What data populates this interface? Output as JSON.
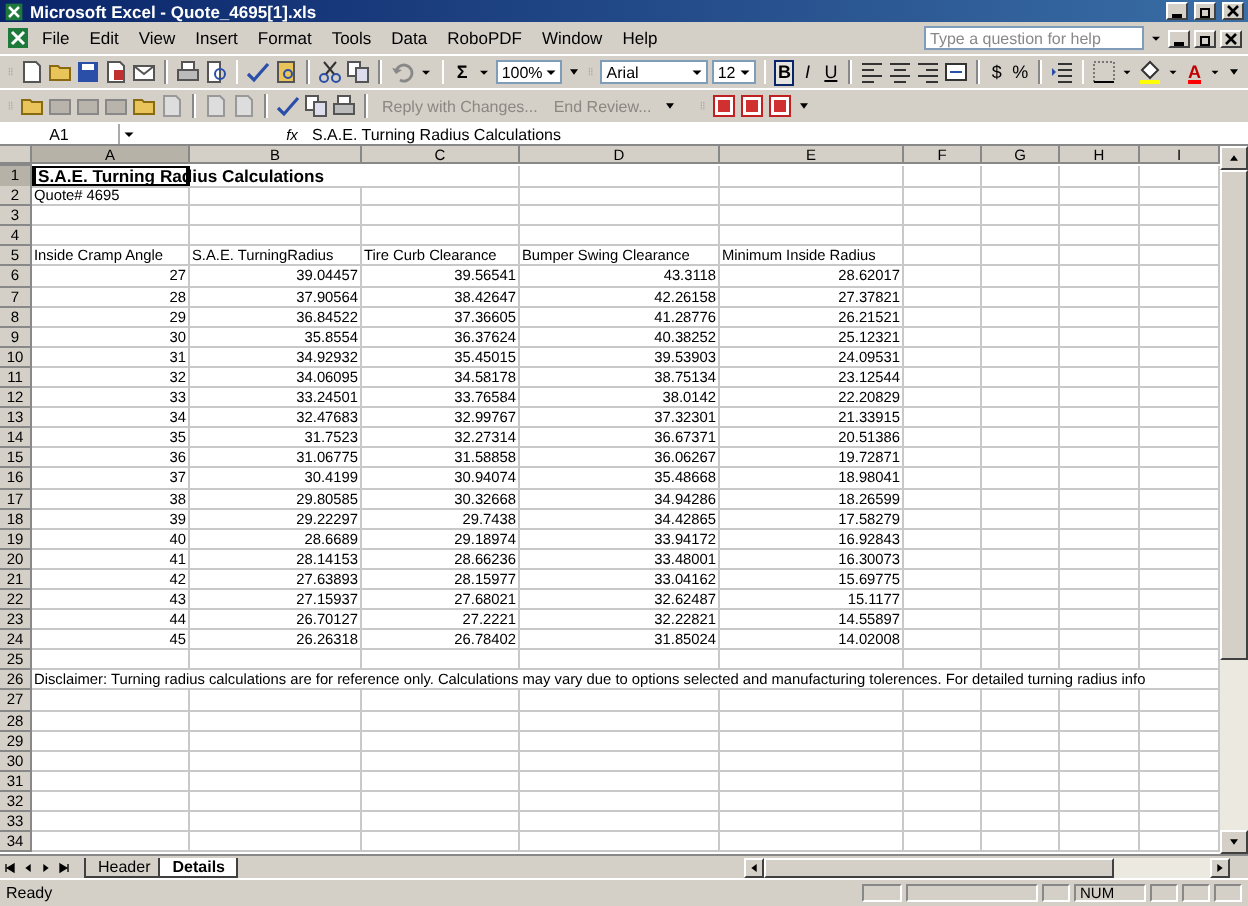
{
  "window": {
    "title": "Microsoft Excel - Quote_4695[1].xls"
  },
  "menu": [
    "File",
    "Edit",
    "View",
    "Insert",
    "Format",
    "Tools",
    "Data",
    "RoboPDF",
    "Window",
    "Help"
  ],
  "help_box": {
    "placeholder": "Type a question for help"
  },
  "standard_toolbar": {
    "sum": "Σ",
    "zoom": "100%"
  },
  "formatting_toolbar": {
    "font": "Arial",
    "size": "12",
    "styles": [
      {
        "label": "B",
        "on": true,
        "kind": "bold"
      },
      {
        "label": "I",
        "on": false,
        "kind": "italic"
      },
      {
        "label": "U",
        "on": false,
        "kind": "underline"
      }
    ],
    "number_buttons": [
      "$",
      "%"
    ],
    "font_color": "A"
  },
  "reviewing_toolbar": {
    "buttons": [
      {
        "label": "Reply with Changes...",
        "disabled": true
      },
      {
        "label": "End Review...",
        "disabled": true
      }
    ]
  },
  "formula_bar": {
    "name_box": "A1",
    "fx": "fx",
    "value": "S.A.E. Turning Radius Calculations"
  },
  "columns": [
    {
      "label": "A",
      "selected": true
    },
    {
      "label": "B",
      "selected": false
    },
    {
      "label": "C",
      "selected": false
    },
    {
      "label": "D",
      "selected": false
    },
    {
      "label": "E",
      "selected": false
    },
    {
      "label": "F",
      "selected": false
    },
    {
      "label": "G",
      "selected": false
    },
    {
      "label": "H",
      "selected": false
    },
    {
      "label": "I",
      "selected": false
    }
  ],
  "rows": [
    {
      "n": "1",
      "kind": "title",
      "selected": true,
      "cells": [
        "S.A.E. Turning Radius Calculations"
      ]
    },
    {
      "n": "2",
      "kind": "text",
      "selected": false,
      "cells": [
        "Quote# 4695"
      ]
    },
    {
      "n": "3",
      "kind": "blank",
      "selected": false
    },
    {
      "n": "4",
      "kind": "blank",
      "selected": false
    },
    {
      "n": "5",
      "kind": "header",
      "selected": false,
      "cells": [
        "Inside Cramp Angle",
        "S.A.E. TurningRadius",
        "Tire Curb Clearance",
        "Bumper Swing Clearance",
        "Minimum Inside Radius"
      ]
    },
    {
      "n": "6",
      "kind": "data",
      "selected": false,
      "cells": [
        "27",
        "39.04457",
        "39.56541",
        "43.3118",
        "28.62017"
      ]
    },
    {
      "n": "7",
      "kind": "data",
      "selected": false,
      "cells": [
        "28",
        "37.90564",
        "38.42647",
        "42.26158",
        "27.37821"
      ]
    },
    {
      "n": "8",
      "kind": "data",
      "selected": false,
      "cells": [
        "29",
        "36.84522",
        "37.36605",
        "41.28776",
        "26.21521"
      ]
    },
    {
      "n": "9",
      "kind": "data",
      "selected": false,
      "cells": [
        "30",
        "35.8554",
        "36.37624",
        "40.38252",
        "25.12321"
      ]
    },
    {
      "n": "10",
      "kind": "data",
      "selected": false,
      "cells": [
        "31",
        "34.92932",
        "35.45015",
        "39.53903",
        "24.09531"
      ]
    },
    {
      "n": "11",
      "kind": "data",
      "selected": false,
      "cells": [
        "32",
        "34.06095",
        "34.58178",
        "38.75134",
        "23.12544"
      ]
    },
    {
      "n": "12",
      "kind": "data",
      "selected": false,
      "cells": [
        "33",
        "33.24501",
        "33.76584",
        "38.0142",
        "22.20829"
      ]
    },
    {
      "n": "13",
      "kind": "data",
      "selected": false,
      "cells": [
        "34",
        "32.47683",
        "32.99767",
        "37.32301",
        "21.33915"
      ]
    },
    {
      "n": "14",
      "kind": "data",
      "selected": false,
      "cells": [
        "35",
        "31.7523",
        "32.27314",
        "36.67371",
        "20.51386"
      ]
    },
    {
      "n": "15",
      "kind": "data",
      "selected": false,
      "cells": [
        "36",
        "31.06775",
        "31.58858",
        "36.06267",
        "19.72871"
      ]
    },
    {
      "n": "16",
      "kind": "data",
      "selected": false,
      "cells": [
        "37",
        "30.4199",
        "30.94074",
        "35.48668",
        "18.98041"
      ]
    },
    {
      "n": "17",
      "kind": "data",
      "selected": false,
      "cells": [
        "38",
        "29.80585",
        "30.32668",
        "34.94286",
        "18.26599"
      ]
    },
    {
      "n": "18",
      "kind": "data",
      "selected": false,
      "cells": [
        "39",
        "29.22297",
        "29.7438",
        "34.42865",
        "17.58279"
      ]
    },
    {
      "n": "19",
      "kind": "data",
      "selected": false,
      "cells": [
        "40",
        "28.6689",
        "29.18974",
        "33.94172",
        "16.92843"
      ]
    },
    {
      "n": "20",
      "kind": "data",
      "selected": false,
      "cells": [
        "41",
        "28.14153",
        "28.66236",
        "33.48001",
        "16.30073"
      ]
    },
    {
      "n": "21",
      "kind": "data",
      "selected": false,
      "cells": [
        "42",
        "27.63893",
        "28.15977",
        "33.04162",
        "15.69775"
      ]
    },
    {
      "n": "22",
      "kind": "data",
      "selected": false,
      "cells": [
        "43",
        "27.15937",
        "27.68021",
        "32.62487",
        "15.1177"
      ]
    },
    {
      "n": "23",
      "kind": "data",
      "selected": false,
      "cells": [
        "44",
        "26.70127",
        "27.2221",
        "32.22821",
        "14.55897"
      ]
    },
    {
      "n": "24",
      "kind": "data",
      "selected": false,
      "cells": [
        "45",
        "26.26318",
        "26.78402",
        "31.85024",
        "14.02008"
      ]
    },
    {
      "n": "25",
      "kind": "blank",
      "selected": false
    },
    {
      "n": "26",
      "kind": "note",
      "selected": false,
      "cells": [
        "Disclaimer: Turning radius calculations are for reference only. Calculations may vary due to options selected and manufacturing tolerences. For detailed turning radius info"
      ]
    },
    {
      "n": "27",
      "kind": "blank",
      "selected": false
    },
    {
      "n": "28",
      "kind": "blank",
      "selected": false
    },
    {
      "n": "29",
      "kind": "blank",
      "selected": false
    },
    {
      "n": "30",
      "kind": "blank",
      "selected": false
    },
    {
      "n": "31",
      "kind": "blank",
      "selected": false
    },
    {
      "n": "32",
      "kind": "blank",
      "selected": false
    },
    {
      "n": "33",
      "kind": "blank",
      "selected": false
    },
    {
      "n": "34",
      "kind": "blank",
      "selected": false
    }
  ],
  "sheet_tabs": [
    {
      "label": "Header",
      "selected": false
    },
    {
      "label": "Details",
      "selected": true
    }
  ],
  "status_bar": {
    "status": "Ready",
    "num_lock": "NUM"
  }
}
